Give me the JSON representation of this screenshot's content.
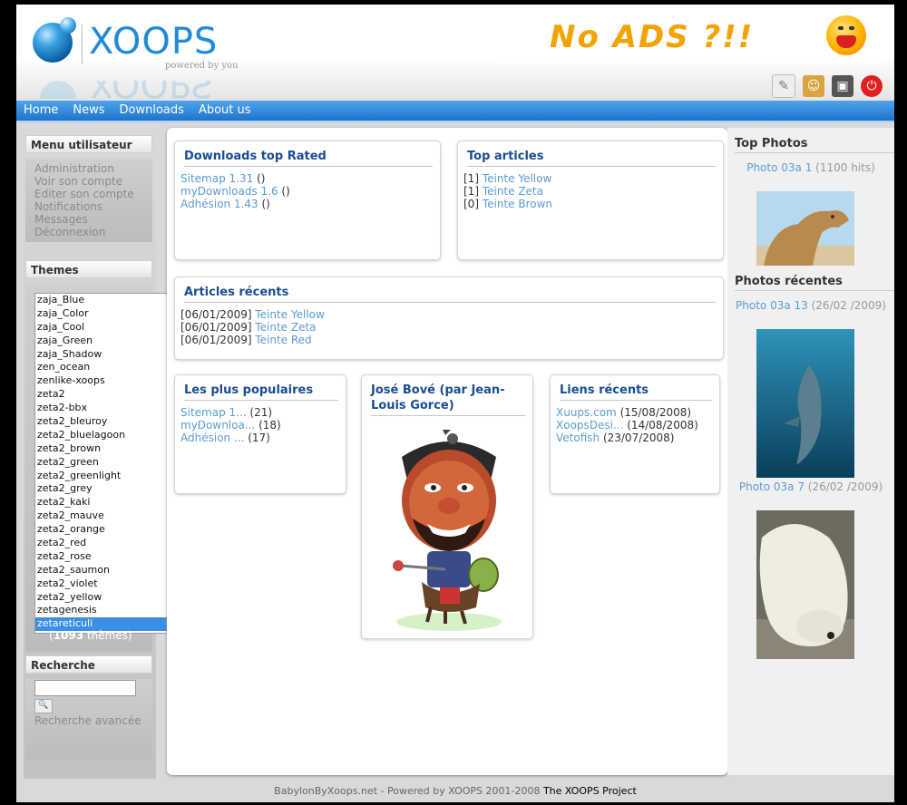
{
  "header": {
    "logo_text": "XOOPS",
    "logo_tagline": "powered by you",
    "banner_text": "No ADS ?!!",
    "icons": [
      "edit-icon",
      "users-icon",
      "screen-icon",
      "power-icon"
    ]
  },
  "nav": [
    "Home",
    "News",
    "Downloads",
    "About us"
  ],
  "left": {
    "user_menu": {
      "title": "Menu utilisateur",
      "items": [
        "Administration",
        "Voir son compte",
        "Editer son compte",
        "Notifications",
        "Messages",
        "Déconnexion"
      ]
    },
    "themes": {
      "title": "Themes",
      "options": [
        "zaja_Blue",
        "zaja_Color",
        "zaja_Cool",
        "zaja_Green",
        "zaja_Shadow",
        "zen_ocean",
        "zenlike-xoops",
        "zeta2",
        "zeta2-bbx",
        "zeta2_bleuroy",
        "zeta2_bluelagoon",
        "zeta2_brown",
        "zeta2_green",
        "zeta2_greenlight",
        "zeta2_grey",
        "zeta2_kaki",
        "zeta2_mauve",
        "zeta2_orange",
        "zeta2_red",
        "zeta2_rose",
        "zeta2_saumon",
        "zeta2_violet",
        "zeta2_yellow",
        "zetagenesis",
        "zetareticuli"
      ],
      "selected": "zetareticuli",
      "count_open": "(",
      "count": "1093",
      "count_suffix": " thèmes)"
    },
    "search": {
      "title": "Recherche",
      "advanced": "Recherche avancée"
    }
  },
  "center": {
    "downloads": {
      "title": "Downloads top Rated",
      "items": [
        {
          "link": "Sitemap 1.31",
          "rest": " ()"
        },
        {
          "link": "myDownloads 1.6",
          "rest": " ()"
        },
        {
          "link": "Adhésion 1.43",
          "rest": " ()"
        }
      ]
    },
    "top_articles": {
      "title": "Top articles",
      "items": [
        {
          "prefix": "[1] ",
          "link": "Teinte Yellow"
        },
        {
          "prefix": "[1] ",
          "link": "Teinte Zeta"
        },
        {
          "prefix": "[0] ",
          "link": "Teinte Brown"
        }
      ]
    },
    "recent_articles": {
      "title": "Articles récents",
      "items": [
        {
          "prefix": "[06/01/2009] ",
          "link": "Teinte Yellow"
        },
        {
          "prefix": "[06/01/2009] ",
          "link": "Teinte Zeta"
        },
        {
          "prefix": "[06/01/2009] ",
          "link": "Teinte Red"
        }
      ]
    },
    "popular": {
      "title": "Les plus populaires",
      "items": [
        {
          "link": "Sitemap 1...",
          "rest": " (21)"
        },
        {
          "link": "myDownloa...",
          "rest": " (18)"
        },
        {
          "link": "Adhésion ...",
          "rest": " (17)"
        }
      ]
    },
    "jose": {
      "title": "José Bové (par Jean-Louis Gorce)"
    },
    "links": {
      "title": "Liens récents",
      "items": [
        {
          "link": "Xuups.com",
          "rest": " (15/08/2008)"
        },
        {
          "link": "XoopsDesi...",
          "rest": " (14/08/2008)"
        },
        {
          "link": "Vetofish",
          "rest": " (23/07/2008)"
        }
      ]
    }
  },
  "right": {
    "top_photos_title": "Top Photos",
    "top_photo": {
      "name": "Photo 03a 1",
      "info": " (1100 hits)"
    },
    "recent_title": "Photos récentes",
    "recent": [
      {
        "name": "Photo 03a 13",
        "info": " (26/02 /2009)"
      },
      {
        "name": "Photo 03a 7",
        "info": " (26/02 /2009)"
      }
    ]
  },
  "footer": {
    "text": "BabylonByXoops.net - Powered by XOOPS 2001-2008 ",
    "link": "The XOOPS Project"
  }
}
